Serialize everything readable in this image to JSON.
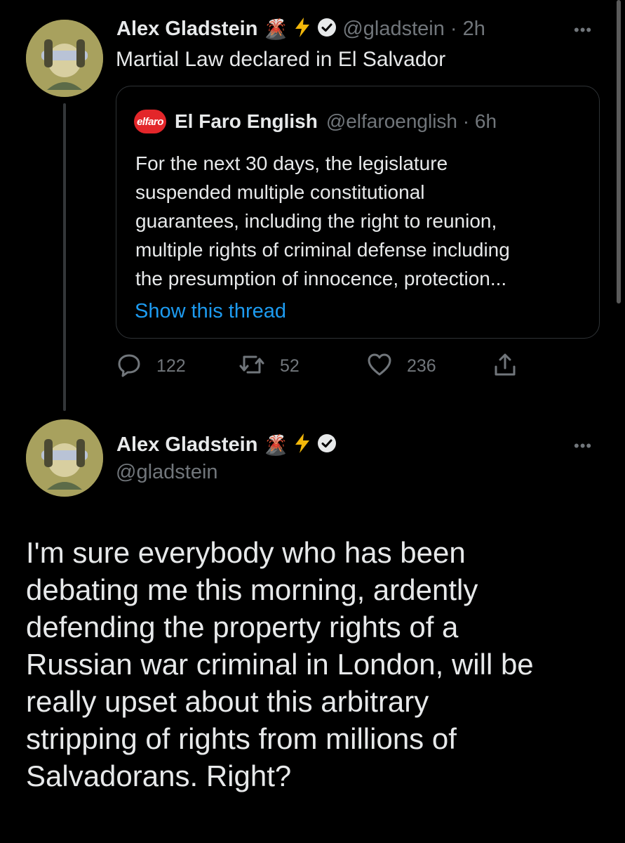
{
  "colors": {
    "background": "#000000",
    "text_primary": "#e7e9ea",
    "text_secondary": "#71767b",
    "link": "#1d9bf0",
    "border": "#2f3336",
    "elfaro_red": "#e3262a",
    "lightning": "#f2b70a"
  },
  "first_tweet": {
    "author_name": "Alex Gladstein",
    "emojis": [
      "volcano-icon",
      "lightning-icon",
      "verified-badge-icon"
    ],
    "handle_time": "@gladstein · 2h",
    "text": "Martial Law declared in El Salvador",
    "quote": {
      "logo_text": "elfaro",
      "author_name": "El Faro English",
      "handle_time": "@elfaroenglish · 6h",
      "lines": [
        "For the next 30 days, the legislature",
        "suspended multiple constitutional",
        "guarantees, including the right to reunion,",
        "multiple rights of criminal defense including",
        "the presumption of innocence, protection..."
      ],
      "show_thread": "Show this thread"
    },
    "actions": {
      "replies": "122",
      "retweets": "52",
      "likes": "236"
    }
  },
  "main_tweet": {
    "author_name": "Alex Gladstein",
    "handle": "@gladstein",
    "lines": [
      "I'm sure everybody who has been",
      "debating me this morning, ardently",
      "defending the property rights of a",
      "Russian war criminal in London, will be",
      "really upset about this arbitrary",
      "stripping of rights from millions of",
      "Salvadorans. Right?"
    ]
  }
}
